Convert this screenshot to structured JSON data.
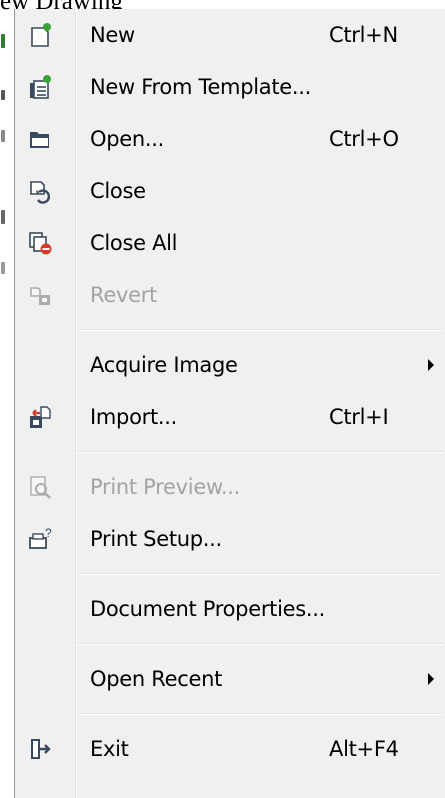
{
  "background": {
    "window_title_fragment": "ew Drawing"
  },
  "menu": {
    "items": [
      {
        "id": "new",
        "label": "New",
        "shortcut": "Ctrl+N",
        "icon": "new-document-icon",
        "enabled": true
      },
      {
        "id": "new-from-template",
        "label": "New From Template...",
        "shortcut": "",
        "icon": "new-from-template-icon",
        "enabled": true
      },
      {
        "id": "open",
        "label": "Open...",
        "shortcut": "Ctrl+O",
        "icon": "folder-open-icon",
        "enabled": true
      },
      {
        "id": "close",
        "label": "Close",
        "shortcut": "",
        "icon": "close-document-icon",
        "enabled": true
      },
      {
        "id": "close-all",
        "label": "Close All",
        "shortcut": "",
        "icon": "close-all-icon",
        "enabled": true
      },
      {
        "id": "revert",
        "label": "Revert",
        "shortcut": "",
        "icon": "revert-icon",
        "enabled": false
      },
      {
        "id": "acquire-image",
        "label": "Acquire Image",
        "shortcut": "",
        "icon": "",
        "enabled": true,
        "submenu": true
      },
      {
        "id": "import",
        "label": "Import...",
        "shortcut": "Ctrl+I",
        "icon": "import-icon",
        "enabled": true
      },
      {
        "id": "print-preview",
        "label": "Print Preview...",
        "shortcut": "",
        "icon": "print-preview-icon",
        "enabled": false
      },
      {
        "id": "print-setup",
        "label": "Print Setup...",
        "shortcut": "",
        "icon": "print-setup-icon",
        "enabled": true
      },
      {
        "id": "document-properties",
        "label": "Document Properties...",
        "shortcut": "",
        "icon": "",
        "enabled": true
      },
      {
        "id": "open-recent",
        "label": "Open Recent",
        "shortcut": "",
        "icon": "",
        "enabled": true,
        "submenu": true
      },
      {
        "id": "exit",
        "label": "Exit",
        "shortcut": "Alt+F4",
        "icon": "exit-icon",
        "enabled": true
      }
    ],
    "colors": {
      "menu_background": "#f0f0f0",
      "disabled_text": "#a3a3a3",
      "separator": "#e2e3e3",
      "icon_accent_green": "#3aa335",
      "icon_accent_red": "#d83b2b",
      "icon_dark": "#3a4a5e"
    }
  }
}
